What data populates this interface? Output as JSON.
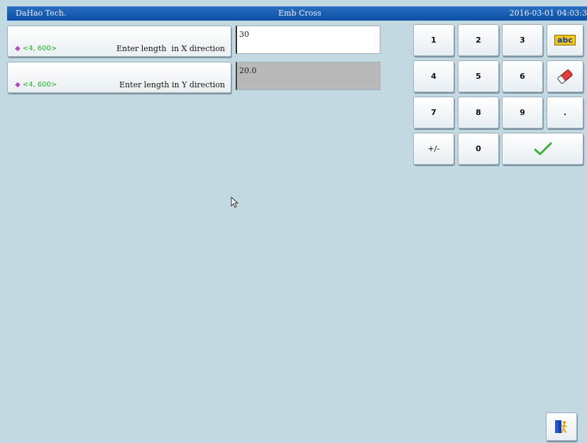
{
  "titlebar": {
    "left": "DaHao Tech.",
    "center": "Emb Cross",
    "right": "2016-03-01 04:03:3"
  },
  "fields": [
    {
      "range": "<4, 600>",
      "label": "Enter length  in X direction",
      "value": "30",
      "active": true
    },
    {
      "range": "<4, 600>",
      "label": "Enter length in Y direction",
      "value": "20.0",
      "active": false
    }
  ],
  "keypad": {
    "k1": "1",
    "k2": "2",
    "k3": "3",
    "k4": "4",
    "k5": "5",
    "k6": "6",
    "k7": "7",
    "k8": "8",
    "k9": "9",
    "dot": ".",
    "plusminus": "+/-",
    "k0": "0",
    "abc": "abc"
  },
  "icons": {
    "abc": "abc-keyboard-icon",
    "erase": "eraser-icon",
    "confirm": "checkmark-icon",
    "exit": "exit-door-icon",
    "range": "diamond-arrow-icon",
    "pointer": "mouse-pointer-icon"
  },
  "colors": {
    "background": "#c3d9e1",
    "titlebar": "#1a5fb8",
    "range_text": "#2fa83a",
    "confirm": "#3cb043",
    "eraser": "#e23b3b"
  }
}
